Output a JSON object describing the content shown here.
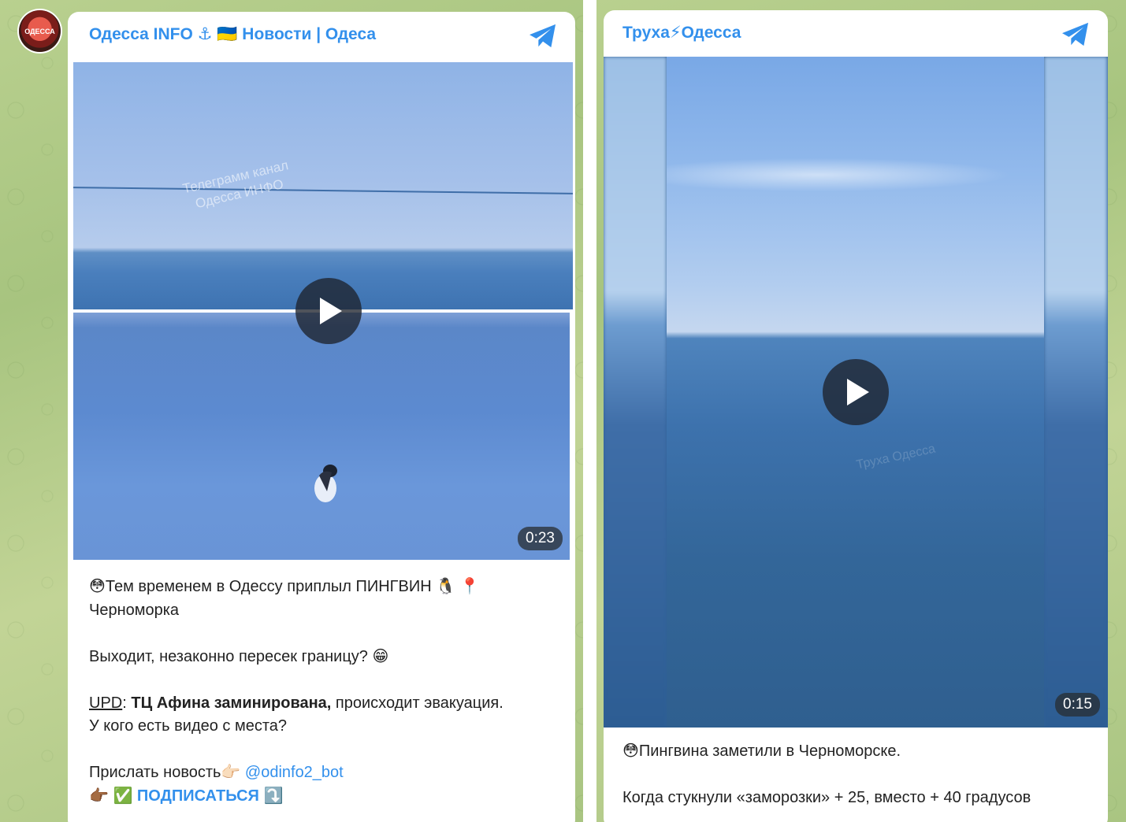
{
  "left_post": {
    "channel_title": "Одесса INFO ⚓ 🇺🇦 Новости | Одеса",
    "avatar_text": "ОДЕССА",
    "watermark_line1": "Телеграмм канал",
    "watermark_line2": "Одесса ИНФО",
    "video_duration": "0:23",
    "line1": "😳Тем временем в Одессу приплыл ПИНГВИН 🐧 📍",
    "line2": "Черноморка",
    "line3": "Выходит, незаконно пересек границу? 😁",
    "upd_label": "UPD",
    "upd_colon": ": ",
    "upd_bold": "ТЦ Афина заминирована,",
    "upd_rest": " происходит эвакуация.",
    "line5": "У кого есть видео с места?",
    "send_news": "Прислать новость👉🏻 ",
    "bot_link": "@odinfo2_bot",
    "subscribe_prefix": "👉🏾 ✅ ",
    "subscribe_label": "ПОДПИСАТЬСЯ",
    "subscribe_suffix": " ⤵️"
  },
  "right_post": {
    "channel_title": "Труха⚡Одесса",
    "watermark": "Труха Одесса",
    "video_duration": "0:15",
    "line1": "😳Пингвина заметили в Черноморске.",
    "line2": "Когда стукнули «заморозки» + 25, вместо + 40 градусов"
  },
  "icons": {
    "telegram": "telegram-plane-icon",
    "play": "play-icon"
  },
  "colors": {
    "accent": "#3390ec"
  }
}
